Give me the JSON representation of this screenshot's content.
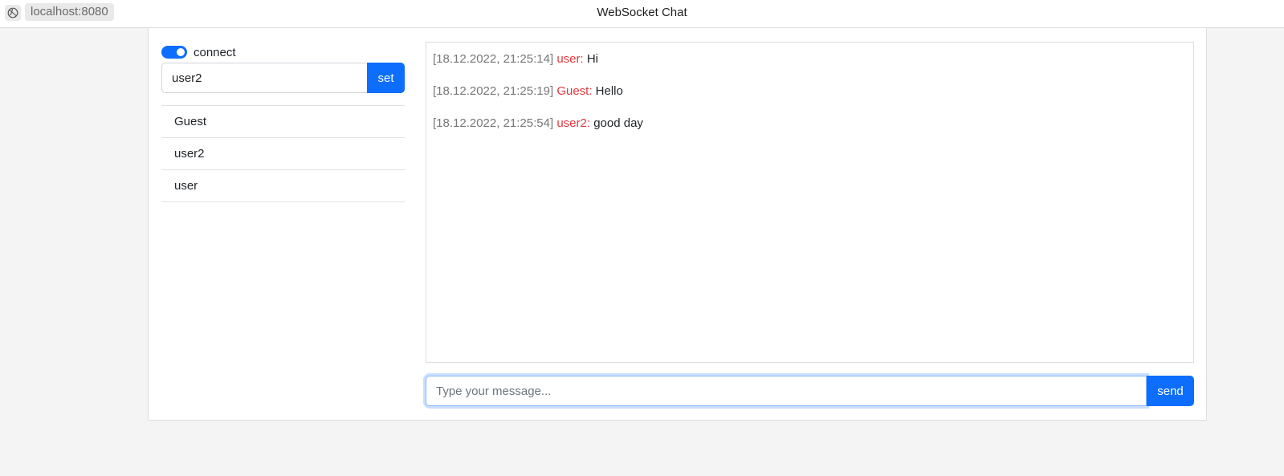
{
  "titlebar": {
    "url": "localhost:8080",
    "title": "WebSocket Chat",
    "site_icon": "globe-icon"
  },
  "sidebar": {
    "connect_label": "connect",
    "connected": true,
    "name_value": "user2",
    "set_label": "set",
    "users": [
      "Guest",
      "user2",
      "user"
    ]
  },
  "chat": {
    "messages": [
      {
        "time": "[18.12.2022, 21:25:14]",
        "author": "user:",
        "text": "Hi"
      },
      {
        "time": "[18.12.2022, 21:25:19]",
        "author": "Guest:",
        "text": "Hello"
      },
      {
        "time": "[18.12.2022, 21:25:54]",
        "author": "user2:",
        "text": "good day"
      }
    ],
    "input_placeholder": "Type your message...",
    "send_label": "send"
  },
  "colors": {
    "accent": "#0d6efd",
    "author": "#e0393e",
    "timestamp": "#777777"
  }
}
